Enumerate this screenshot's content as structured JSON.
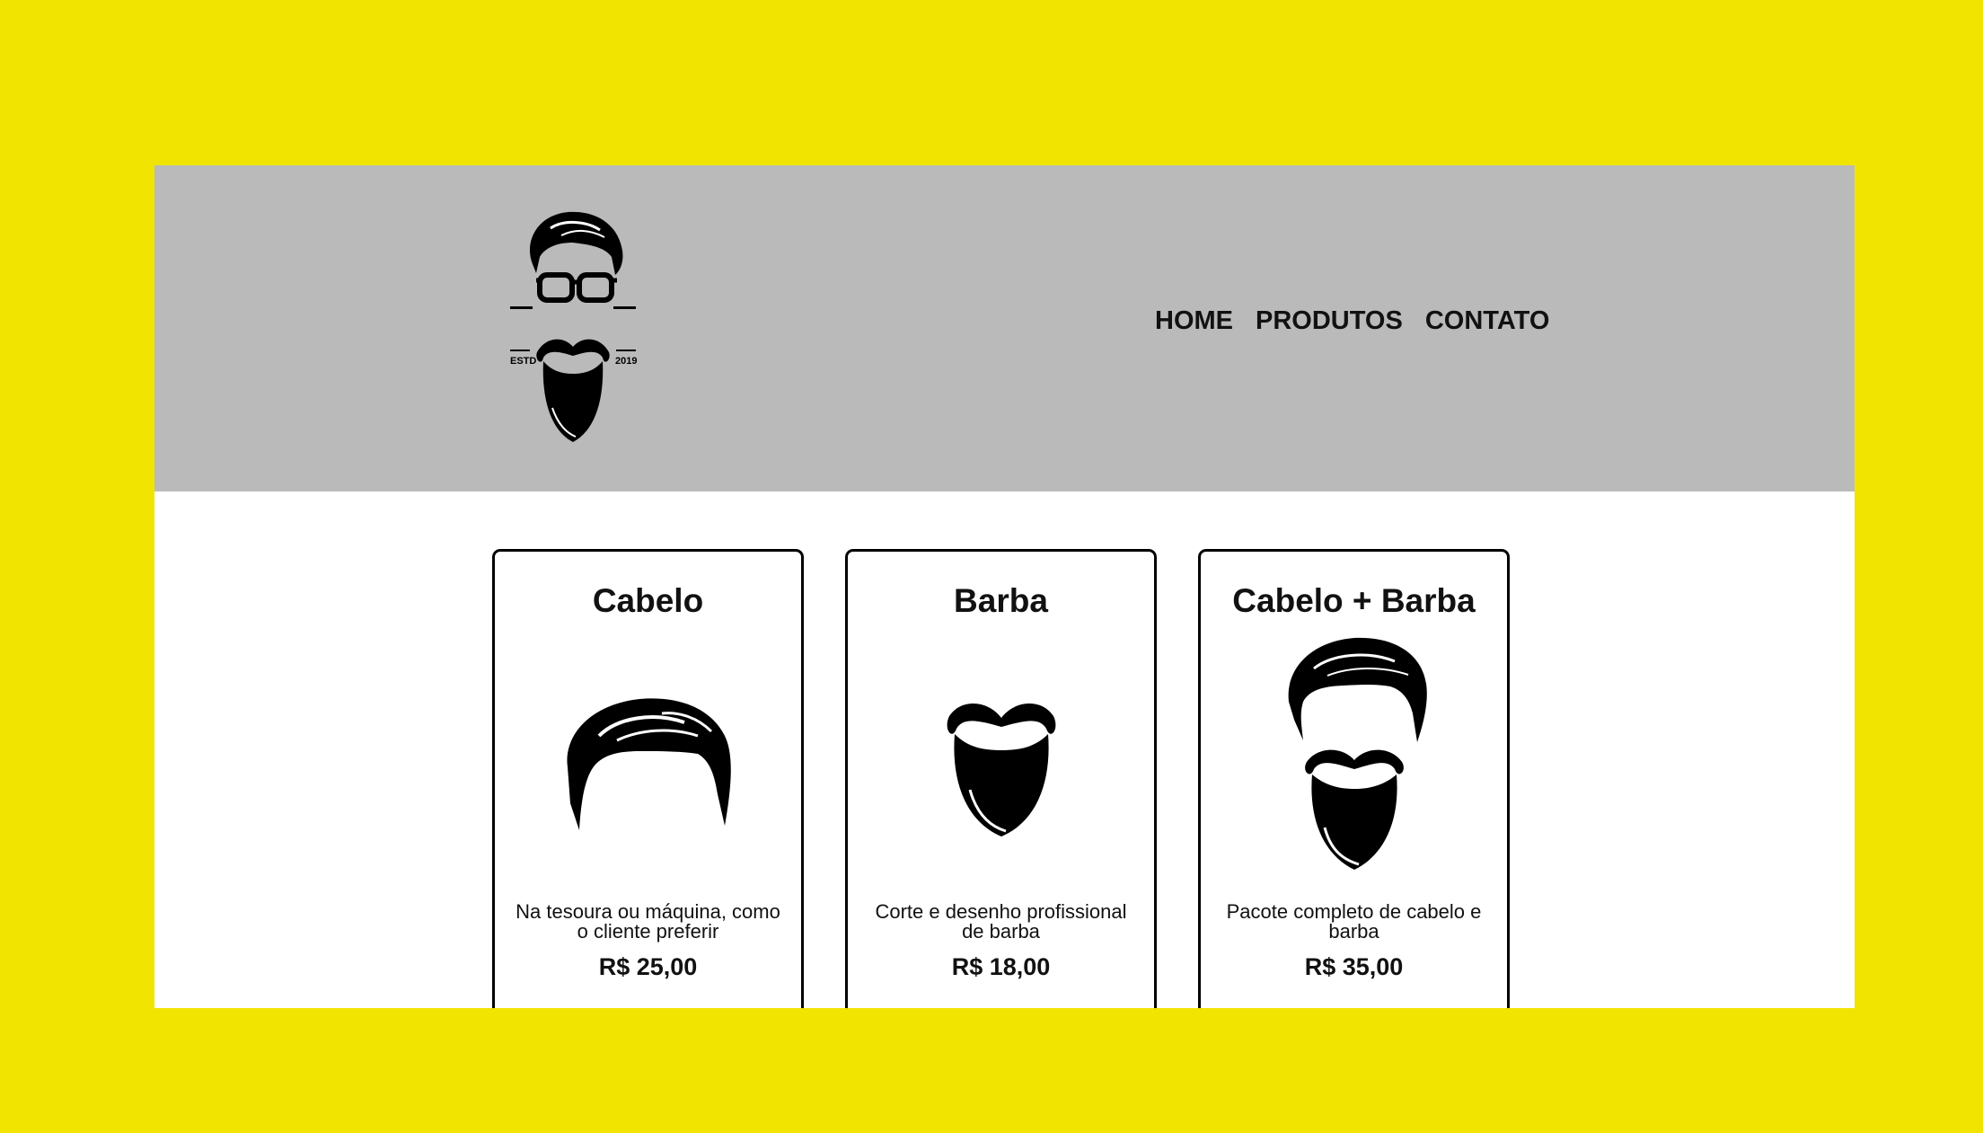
{
  "header": {
    "logo": {
      "icon": "barber-logo-icon",
      "left_text": "ESTD",
      "right_text": "2019"
    },
    "nav": [
      {
        "label": "HOME"
      },
      {
        "label": "PRODUTOS"
      },
      {
        "label": "CONTATO"
      }
    ]
  },
  "products": [
    {
      "title": "Cabelo",
      "icon": "hair-icon",
      "description": "Na tesoura ou máquina, como o cliente preferir",
      "price": "R$ 25,00"
    },
    {
      "title": "Barba",
      "icon": "beard-icon",
      "description": "Corte e desenho profissional de barba",
      "price": "R$ 18,00"
    },
    {
      "title": "Cabelo + Barba",
      "icon": "hair-and-beard-icon",
      "description": "Pacote completo de cabelo e barba",
      "price": "R$ 35,00"
    }
  ],
  "colors": {
    "background": "#f0e400",
    "header": "#bababa",
    "content": "#ffffff",
    "text": "#111111"
  }
}
